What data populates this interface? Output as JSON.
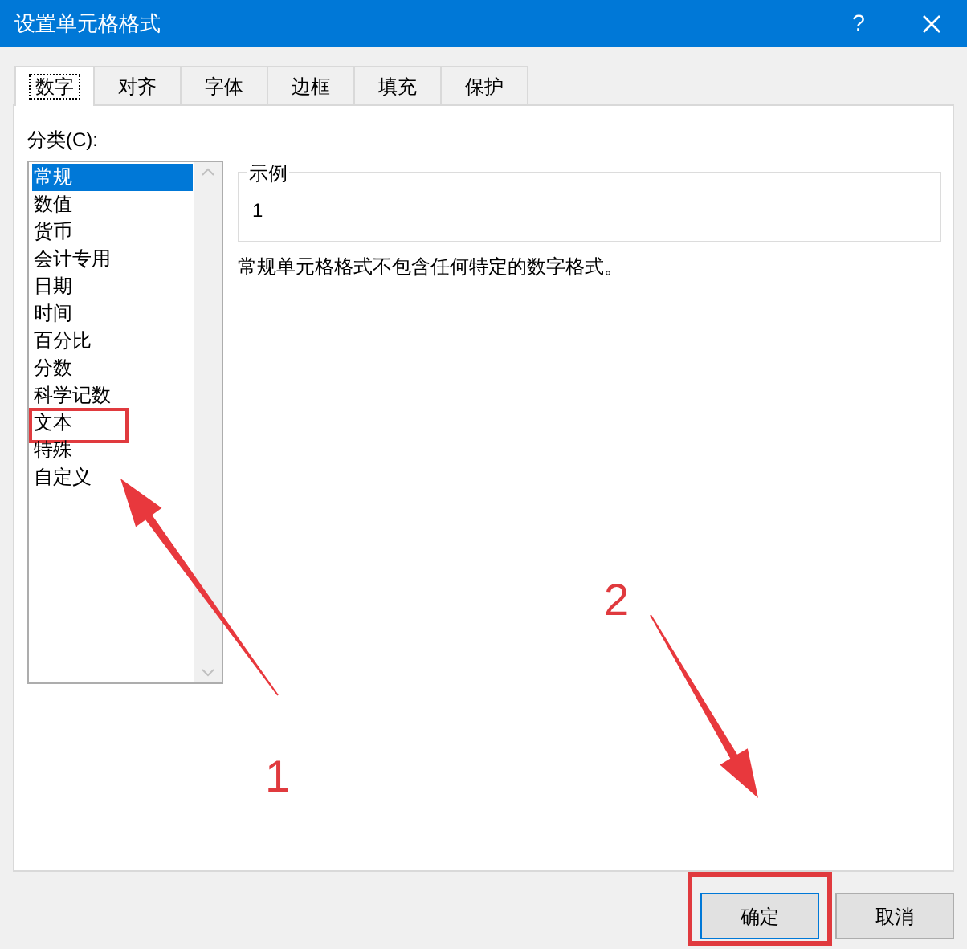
{
  "window": {
    "title": "设置单元格格式",
    "help": "?"
  },
  "tabs": [
    {
      "label": "数字",
      "selected": true
    },
    {
      "label": "对齐",
      "selected": false
    },
    {
      "label": "字体",
      "selected": false
    },
    {
      "label": "边框",
      "selected": false
    },
    {
      "label": "填充",
      "selected": false
    },
    {
      "label": "保护",
      "selected": false
    }
  ],
  "category": {
    "label": "分类(C):",
    "items": [
      {
        "label": "常规",
        "selected": true,
        "highlighted": false
      },
      {
        "label": "数值",
        "selected": false,
        "highlighted": false
      },
      {
        "label": "货币",
        "selected": false,
        "highlighted": false
      },
      {
        "label": "会计专用",
        "selected": false,
        "highlighted": false
      },
      {
        "label": "日期",
        "selected": false,
        "highlighted": false
      },
      {
        "label": "时间",
        "selected": false,
        "highlighted": false
      },
      {
        "label": "百分比",
        "selected": false,
        "highlighted": false
      },
      {
        "label": "分数",
        "selected": false,
        "highlighted": false
      },
      {
        "label": "科学记数",
        "selected": false,
        "highlighted": false
      },
      {
        "label": "文本",
        "selected": false,
        "highlighted": true
      },
      {
        "label": "特殊",
        "selected": false,
        "highlighted": false
      },
      {
        "label": "自定义",
        "selected": false,
        "highlighted": false
      }
    ]
  },
  "sample": {
    "label": "示例",
    "value": "1"
  },
  "description": "常规单元格格式不包含任何特定的数字格式。",
  "buttons": [
    {
      "label": "确定",
      "highlighted": true
    },
    {
      "label": "取消",
      "highlighted": false
    }
  ],
  "annotations": [
    {
      "label": "1"
    },
    {
      "label": "2"
    }
  ]
}
